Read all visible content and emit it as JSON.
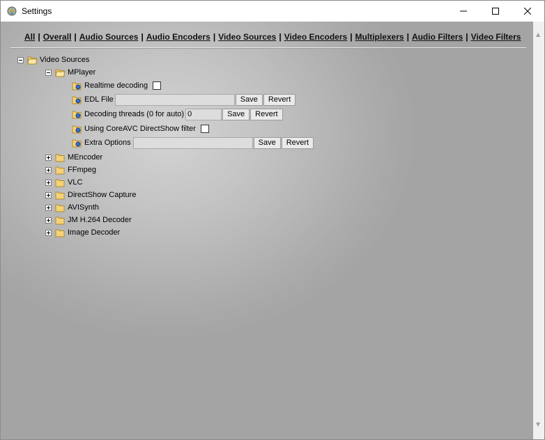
{
  "window": {
    "title": "Settings"
  },
  "nav": [
    "All",
    "Overall",
    "Audio Sources",
    "Audio Encoders",
    "Video Sources",
    "Video Encoders",
    "Multiplexers",
    "Audio Filters",
    "Video Filters"
  ],
  "nav_separator": "|",
  "tree": {
    "root_label": "Video Sources",
    "mplayer": {
      "label": "MPlayer",
      "options": {
        "realtime": "Realtime decoding",
        "edl": "EDL File",
        "threads": "Decoding threads (0 for auto)",
        "threads_value": "0",
        "coreavc": "Using CoreAVC DirectShow filter",
        "extra": "Extra Options"
      }
    },
    "siblings": [
      "MEncoder",
      "FFmpeg",
      "VLC",
      "DirectShow Capture",
      "AVISynth",
      "JM H.264 Decoder",
      "Image Decoder"
    ]
  },
  "buttons": {
    "save": "Save",
    "revert": "Revert"
  }
}
